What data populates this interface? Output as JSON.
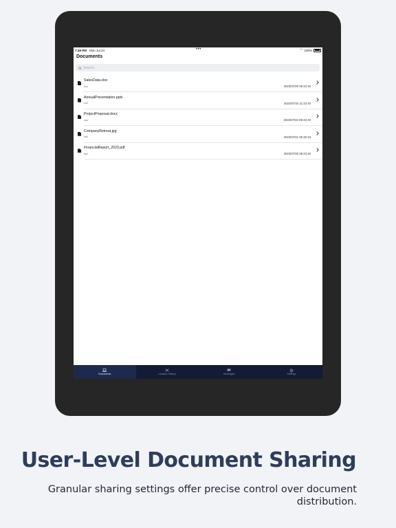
{
  "status_bar": {
    "time": "7:49 PM",
    "date": "Mon Jul 24",
    "battery": "100%"
  },
  "nav": {
    "title": "Documents"
  },
  "search": {
    "placeholder": "Search..."
  },
  "documents": [
    {
      "name": "SalesData.xlsx",
      "type": "csv",
      "date": "2023/07/20 06:22:40"
    },
    {
      "name": "AnnualPresentation.pptx",
      "type": "csv",
      "date": "2023/07/24 11:22:40"
    },
    {
      "name": "ProjectProposal.docx",
      "type": "csv",
      "date": "2023/07/22 06:22:40"
    },
    {
      "name": "CompanyRetreat.jpg",
      "type": "csv",
      "date": "2023/07/21 06:45:34"
    },
    {
      "name": "FinancialReport_2023.pdf",
      "type": "csv",
      "date": "2023/07/20 06:22:40"
    }
  ],
  "tabs": [
    {
      "label": "Documents",
      "icon": "laptop-icon",
      "active": true
    },
    {
      "label": "Location History",
      "icon": "map-pin-icon",
      "active": false
    },
    {
      "label": "Messages",
      "icon": "chat-bubble-icon",
      "active": false
    },
    {
      "label": "Settings",
      "icon": "gear-icon",
      "active": false
    }
  ],
  "marketing": {
    "headline": "User-Level Document Sharing",
    "subline": "Granular sharing settings offer precise control over document distribution."
  },
  "colors": {
    "accent": "#2e3d5a",
    "tabbar": "#131b36",
    "background": "#f2f3f7"
  }
}
